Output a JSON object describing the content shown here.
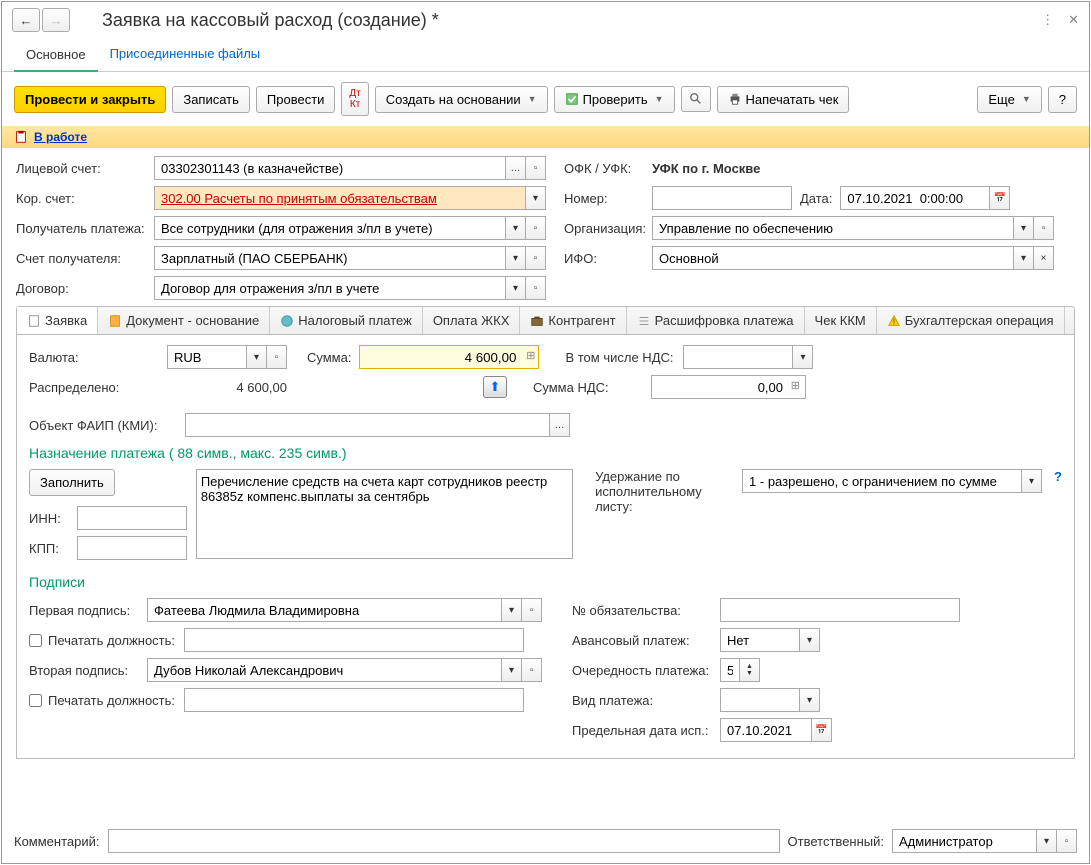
{
  "window": {
    "title": "Заявка на кассовый расход (создание) *"
  },
  "navtabs": {
    "main": "Основное",
    "files": "Присоединенные файлы"
  },
  "toolbar": {
    "post_close": "Провести и закрыть",
    "save": "Записать",
    "post": "Провести",
    "create_from": "Создать на основании",
    "check": "Проверить",
    "print_receipt": "Напечатать чек",
    "more": "Еще",
    "help": "?"
  },
  "status": {
    "label": "В работе"
  },
  "fields": {
    "account_label": "Лицевой счет:",
    "account_value": "03302301143 (в казначействе)",
    "ofk_label": "ОФК / УФК:",
    "ofk_value": "УФК по г. Москве",
    "corr_label": "Кор. счет:",
    "corr_value": "302.00 Расчеты по принятым обязательствам",
    "number_label": "Номер:",
    "number_value": "",
    "date_label": "Дата:",
    "date_value": "07.10.2021  0:00:00",
    "payee_label": "Получатель платежа:",
    "payee_value": "Все сотрудники (для отражения з/пл в учете)",
    "org_label": "Организация:",
    "org_value": "Управление по обеспечению",
    "payee_acc_label": "Счет получателя:",
    "payee_acc_value": "Зарплатный (ПАО СБЕРБАНК)",
    "ifo_label": "ИФО:",
    "ifo_value": "Основной",
    "contract_label": "Договор:",
    "contract_value": "Договор для отражения з/пл в учете"
  },
  "tabs": {
    "request": "Заявка",
    "basis": "Документ - основание",
    "tax": "Налоговый платеж",
    "utilities": "Оплата ЖКХ",
    "counterparty": "Контрагент",
    "decoding": "Расшифровка платежа",
    "kkm": "Чек ККМ",
    "accounting": "Бухгалтерская операция"
  },
  "request": {
    "currency_label": "Валюта:",
    "currency_value": "RUB",
    "sum_label": "Сумма:",
    "sum_value": "4 600,00",
    "vat_incl_label": "В том числе НДС:",
    "distributed_label": "Распределено:",
    "distributed_value": "4 600,00",
    "vat_sum_label": "Сумма НДС:",
    "vat_sum_value": "0,00",
    "faip_label": "Объект ФАИП (КМИ):",
    "purpose_title": "Назначение платежа ( 88 симв., макс. 235 симв.)",
    "fill_btn": "Заполнить",
    "purpose_text": "Перечисление средств на счета карт сотрудников реестр 86385z компенс.выплаты за сентябрь",
    "inn_label": "ИНН:",
    "kpp_label": "КПП:",
    "garnish_label": "Удержание по исполнительному листу:",
    "garnish_value": "1 - разрешено, с ограничением по сумме",
    "signatures_title": "Подписи",
    "obligation_label": "№ обязательства:",
    "sig1_label": "Первая подпись:",
    "sig1_value": "Фатеева Людмила Владимировна",
    "advance_label": "Авансовый платеж:",
    "advance_value": "Нет",
    "print_post1": "Печатать должность:",
    "priority_label": "Очередность платежа:",
    "priority_value": "5",
    "sig2_label": "Вторая подпись:",
    "sig2_value": "Дубов Николай Александрович",
    "pay_type_label": "Вид платежа:",
    "print_post2": "Печатать должность:",
    "deadline_label": "Предельная дата исп.:",
    "deadline_value": "07.10.2021"
  },
  "footer": {
    "comment_label": "Комментарий:",
    "responsible_label": "Ответственный:",
    "responsible_value": "Администратор"
  }
}
